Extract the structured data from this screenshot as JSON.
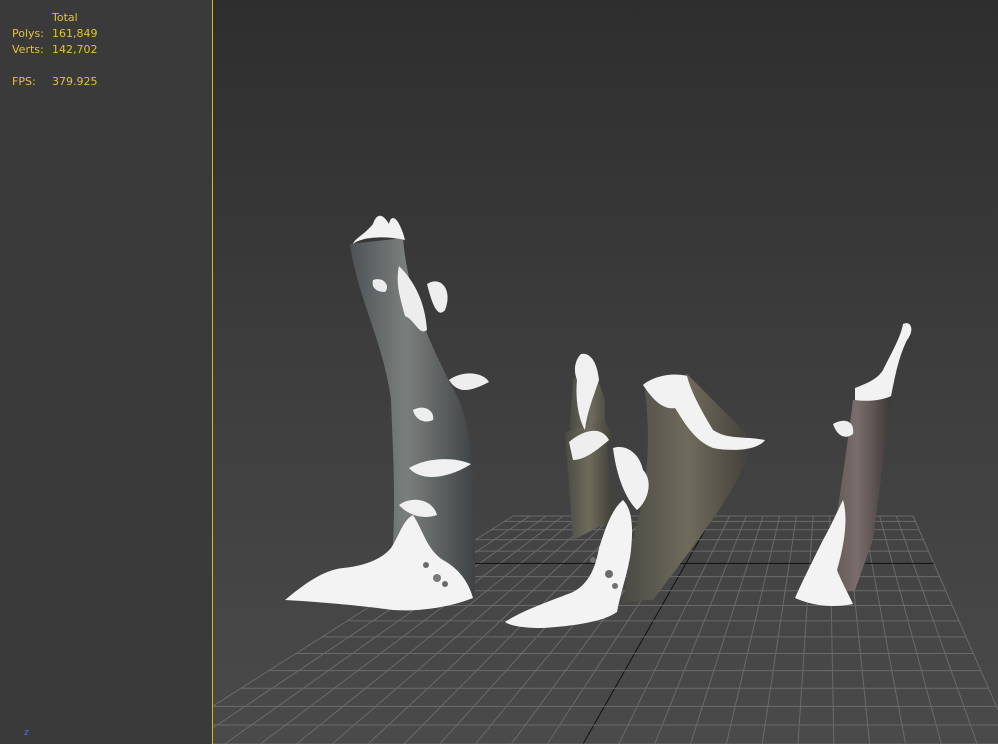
{
  "stats": {
    "header": "Total",
    "polys_label": "Polys:",
    "polys_value": "161,849",
    "verts_label": "Verts:",
    "verts_value": "142,702",
    "fps_label": "FPS:",
    "fps_value": "379.925"
  },
  "gizmo": {
    "z_label": "z"
  },
  "colors": {
    "stats_text": "#e2c23a",
    "viewport_border": "#d8b820",
    "grid_line": "#6a6a6a",
    "grid_axis": "#111111",
    "snow": "#f2f2f2",
    "bark": "#6b6f6a"
  },
  "scene": {
    "objects": [
      "snowy-stump-left",
      "snowy-stump-center",
      "snowy-stump-right"
    ]
  }
}
